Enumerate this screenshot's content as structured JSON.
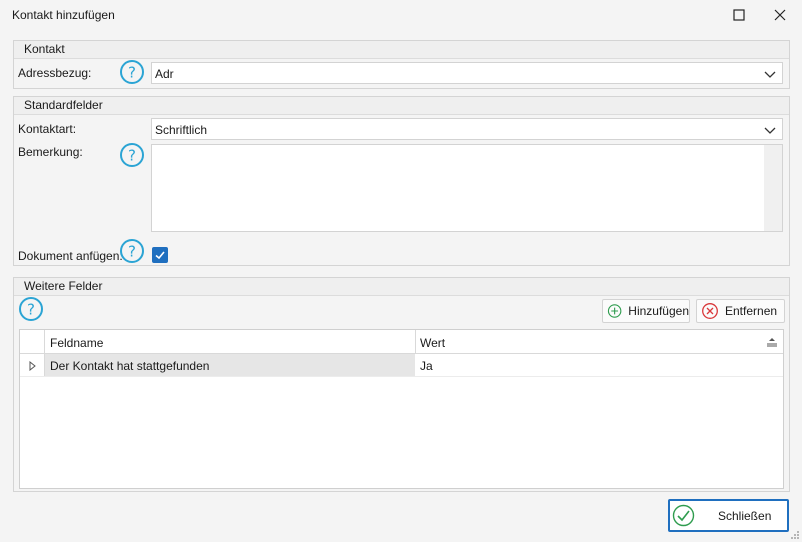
{
  "window": {
    "title": "Kontakt hinzufügen"
  },
  "kontakt_group": {
    "header": "Kontakt",
    "adressbezug_label": "Adressbezug:",
    "adressbezug_value": "Adr"
  },
  "standard_group": {
    "header": "Standardfelder",
    "kontaktart_label": "Kontaktart:",
    "kontaktart_value": "Schriftlich",
    "bemerkung_label": "Bemerkung:",
    "bemerkung_value": "",
    "dokument_label": "Dokument anfügen:",
    "dokument_checked": true
  },
  "weitere_group": {
    "header": "Weitere Felder",
    "add_label": "Hinzufügen",
    "remove_label": "Entfernen",
    "columns": [
      "Feldname",
      "Wert"
    ],
    "rows": [
      {
        "feldname": "Der Kontakt hat stattgefunden",
        "wert": "Ja"
      }
    ]
  },
  "footer": {
    "close_label": "Schließen"
  },
  "colors": {
    "accent": "#1f6fbf",
    "help": "#2ba4d4",
    "add_green": "#2e9c4e",
    "remove_red": "#d9383a"
  },
  "icons": {
    "help": "help-circle-icon",
    "add": "plus-circle-icon",
    "remove": "x-circle-icon",
    "close": "check-circle-icon"
  }
}
